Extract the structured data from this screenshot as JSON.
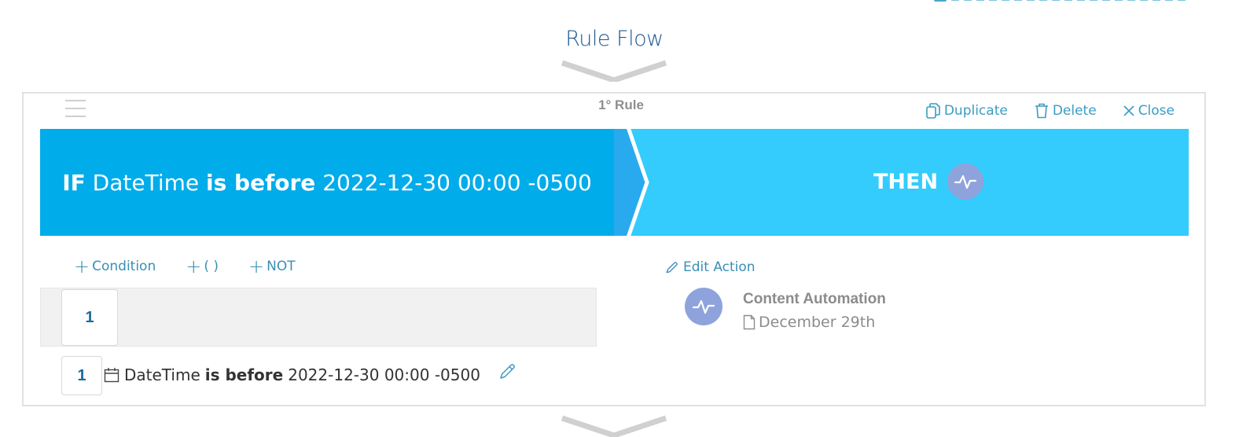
{
  "page": {
    "title": "Rule Flow"
  },
  "rule": {
    "label": "1° Rule",
    "actions": {
      "duplicate": "Duplicate",
      "delete": "Delete",
      "close": "Close"
    },
    "banner": {
      "if_keyword": "IF",
      "field": "DateTime",
      "operator": "is before",
      "value": "2022-12-30 00:00 -0500",
      "then_keyword": "THEN",
      "then_icon": "activity-pulse-icon"
    },
    "condition_toolbar": {
      "add_condition": "Condition",
      "add_group": "( )",
      "add_not": "NOT"
    },
    "group": {
      "number": "1"
    },
    "conditions": [
      {
        "number": "1",
        "icon": "calendar-icon",
        "field": "DateTime",
        "operator": "is before",
        "value": "2022-12-30 00:00 -0500"
      }
    ],
    "action_panel": {
      "edit_label": "Edit Action",
      "item": {
        "icon": "activity-pulse-icon",
        "title": "Content Automation",
        "subtitle_icon": "document-icon",
        "subtitle": "December 29th"
      }
    }
  },
  "colors": {
    "if_bg": "#00acea",
    "then_bg": "#33ccfd",
    "accent_link": "#3a9cc4",
    "icon_circle": "#8ea3dc",
    "title": "#1f5a94"
  }
}
